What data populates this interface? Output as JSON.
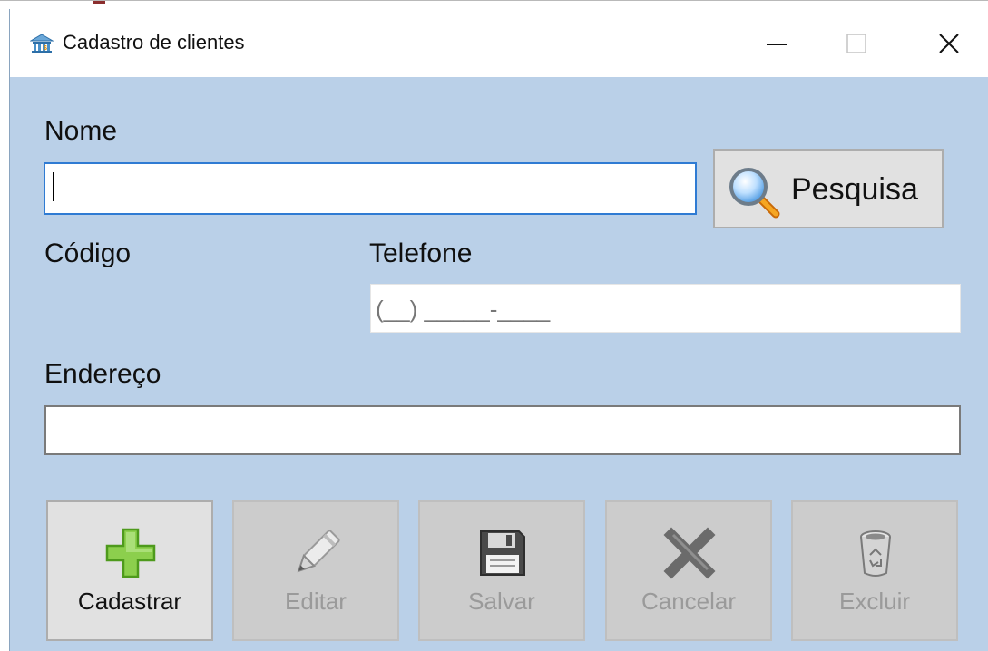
{
  "window": {
    "title": "Cadastro de clientes",
    "app_icon": "bank-icon",
    "controls": [
      "minimize-icon",
      "maximize-icon",
      "close-icon"
    ]
  },
  "form": {
    "nome_label": "Nome",
    "nome_value": "",
    "codigo_label": "Código",
    "codigo_value": "",
    "telefone_label": "Telefone",
    "telefone_mask": "(__) _____-____",
    "endereco_label": "Endereço",
    "endereco_value": ""
  },
  "search_button": {
    "label": "Pesquisa",
    "icon": "magnifier-icon"
  },
  "actions": [
    {
      "label": "Cadastrar",
      "icon": "plus-icon",
      "enabled": true
    },
    {
      "label": "Editar",
      "icon": "pencil-icon",
      "enabled": false
    },
    {
      "label": "Salvar",
      "icon": "floppy-disk-icon",
      "enabled": false
    },
    {
      "label": "Cancelar",
      "icon": "x-icon",
      "enabled": false
    },
    {
      "label": "Excluir",
      "icon": "recycle-bin-icon",
      "enabled": false
    }
  ],
  "colors": {
    "form_background": "#bad0e8",
    "focus_border": "#2f7bd3",
    "plus_green": "#7cc142"
  }
}
